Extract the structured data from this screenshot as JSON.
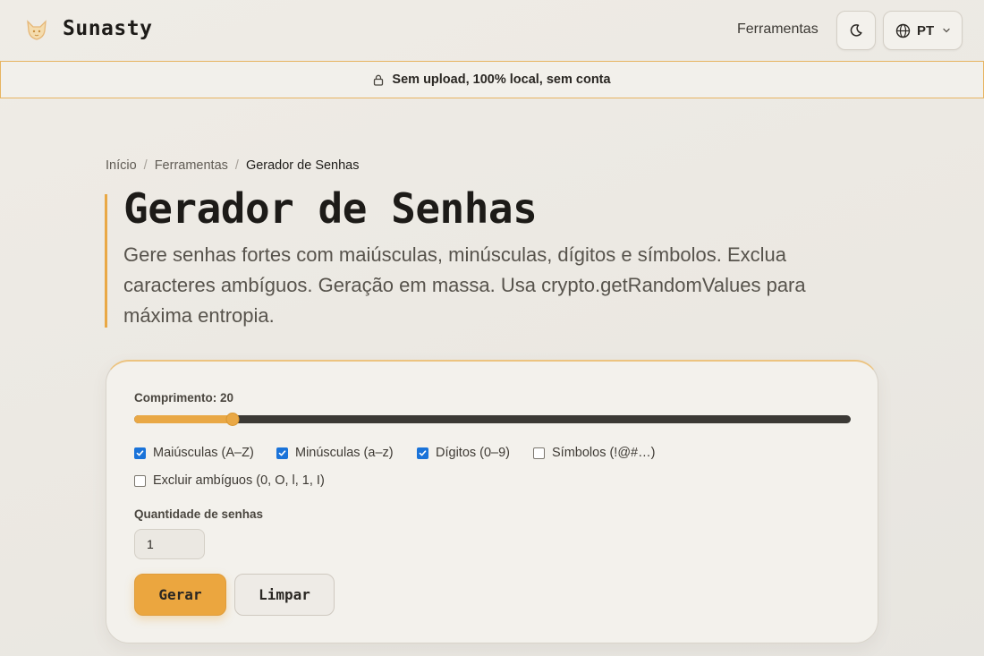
{
  "header": {
    "brand": "Sunasty",
    "logo_icon": "fox-logo-icon",
    "nav_tools": "Ferramentas",
    "theme_icon": "moon-icon",
    "language": "PT",
    "language_icon": "globe-icon",
    "language_chevron": "chevron-down-icon"
  },
  "banner": {
    "icon": "lock-icon",
    "text": "Sem upload, 100% local, sem conta"
  },
  "breadcrumb": {
    "items": [
      "Início",
      "Ferramentas",
      "Gerador de Senhas"
    ],
    "separator": "/"
  },
  "hero": {
    "title": "Gerador de Senhas",
    "description": "Gere senhas fortes com maiúsculas, minúsculas, dígitos e símbolos. Exclua caracteres ambíguos. Geração em massa. Usa crypto.getRandomValues para máxima entropia."
  },
  "form": {
    "length_label": "Comprimento: 20",
    "length_value": 20,
    "length_fraction": 0.137,
    "options": [
      {
        "label": "Maiúsculas (A–Z)",
        "checked": true
      },
      {
        "label": "Minúsculas (a–z)",
        "checked": true
      },
      {
        "label": "Dígitos (0–9)",
        "checked": true
      },
      {
        "label": "Símbolos (!@#…)",
        "checked": false
      },
      {
        "label": "Excluir ambíguos (0, O, l, 1, I)",
        "checked": false
      }
    ],
    "quantity_label": "Quantidade de senhas",
    "quantity_value": "1",
    "generate_label": "Gerar",
    "clear_label": "Limpar"
  },
  "colors": {
    "accent": "#e9a845",
    "checkbox": "#1a73d9",
    "background": "#efece6"
  }
}
